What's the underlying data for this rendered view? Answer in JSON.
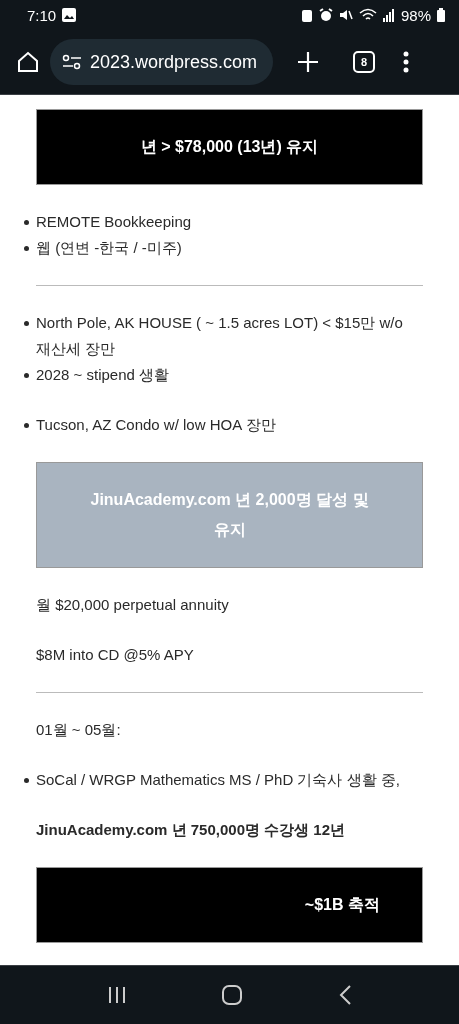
{
  "status_bar": {
    "time": "7:10",
    "battery": "98%"
  },
  "browser": {
    "url": "2023.wordpress.com",
    "tab_count": "8"
  },
  "content": [
    {
      "kind": "banner",
      "muted": false,
      "right_aligned": false,
      "text": "년 > $78,000 (13년) 유지"
    },
    {
      "kind": "list",
      "items": [
        "REMOTE Bookkeeping",
        "웹 (연변 -한국 / -미주)"
      ]
    },
    {
      "kind": "rule"
    },
    {
      "kind": "list",
      "items": [
        "North Pole, AK HOUSE ( ~ 1.5 acres LOT) < $15만 w/o 재산세 장만",
        "2028 ~ stipend 생활"
      ]
    },
    {
      "kind": "list",
      "items": [
        "Tucson, AZ Condo w/ low HOA 장만"
      ]
    },
    {
      "kind": "banner",
      "muted": true,
      "right_aligned": false,
      "text": "JinuAcademy.com 년 2,000명 달성 및 유지"
    },
    {
      "kind": "text",
      "bold": false,
      "text": "월 $20,000 perpetual annuity"
    },
    {
      "kind": "text",
      "bold": false,
      "text": "$8M into CD @5% APY"
    },
    {
      "kind": "rule"
    },
    {
      "kind": "text",
      "bold": false,
      "text": "01월 ~ 05월:"
    },
    {
      "kind": "list",
      "items": [
        "SoCal / WRGP Mathematics MS / PhD 기숙사 생활 중,"
      ]
    },
    {
      "kind": "text",
      "bold": true,
      "text": "JinuAcademy.com 년 750,000명 수강생 12년"
    },
    {
      "kind": "banner",
      "muted": false,
      "right_aligned": true,
      "text": "~$1B 축적"
    }
  ]
}
